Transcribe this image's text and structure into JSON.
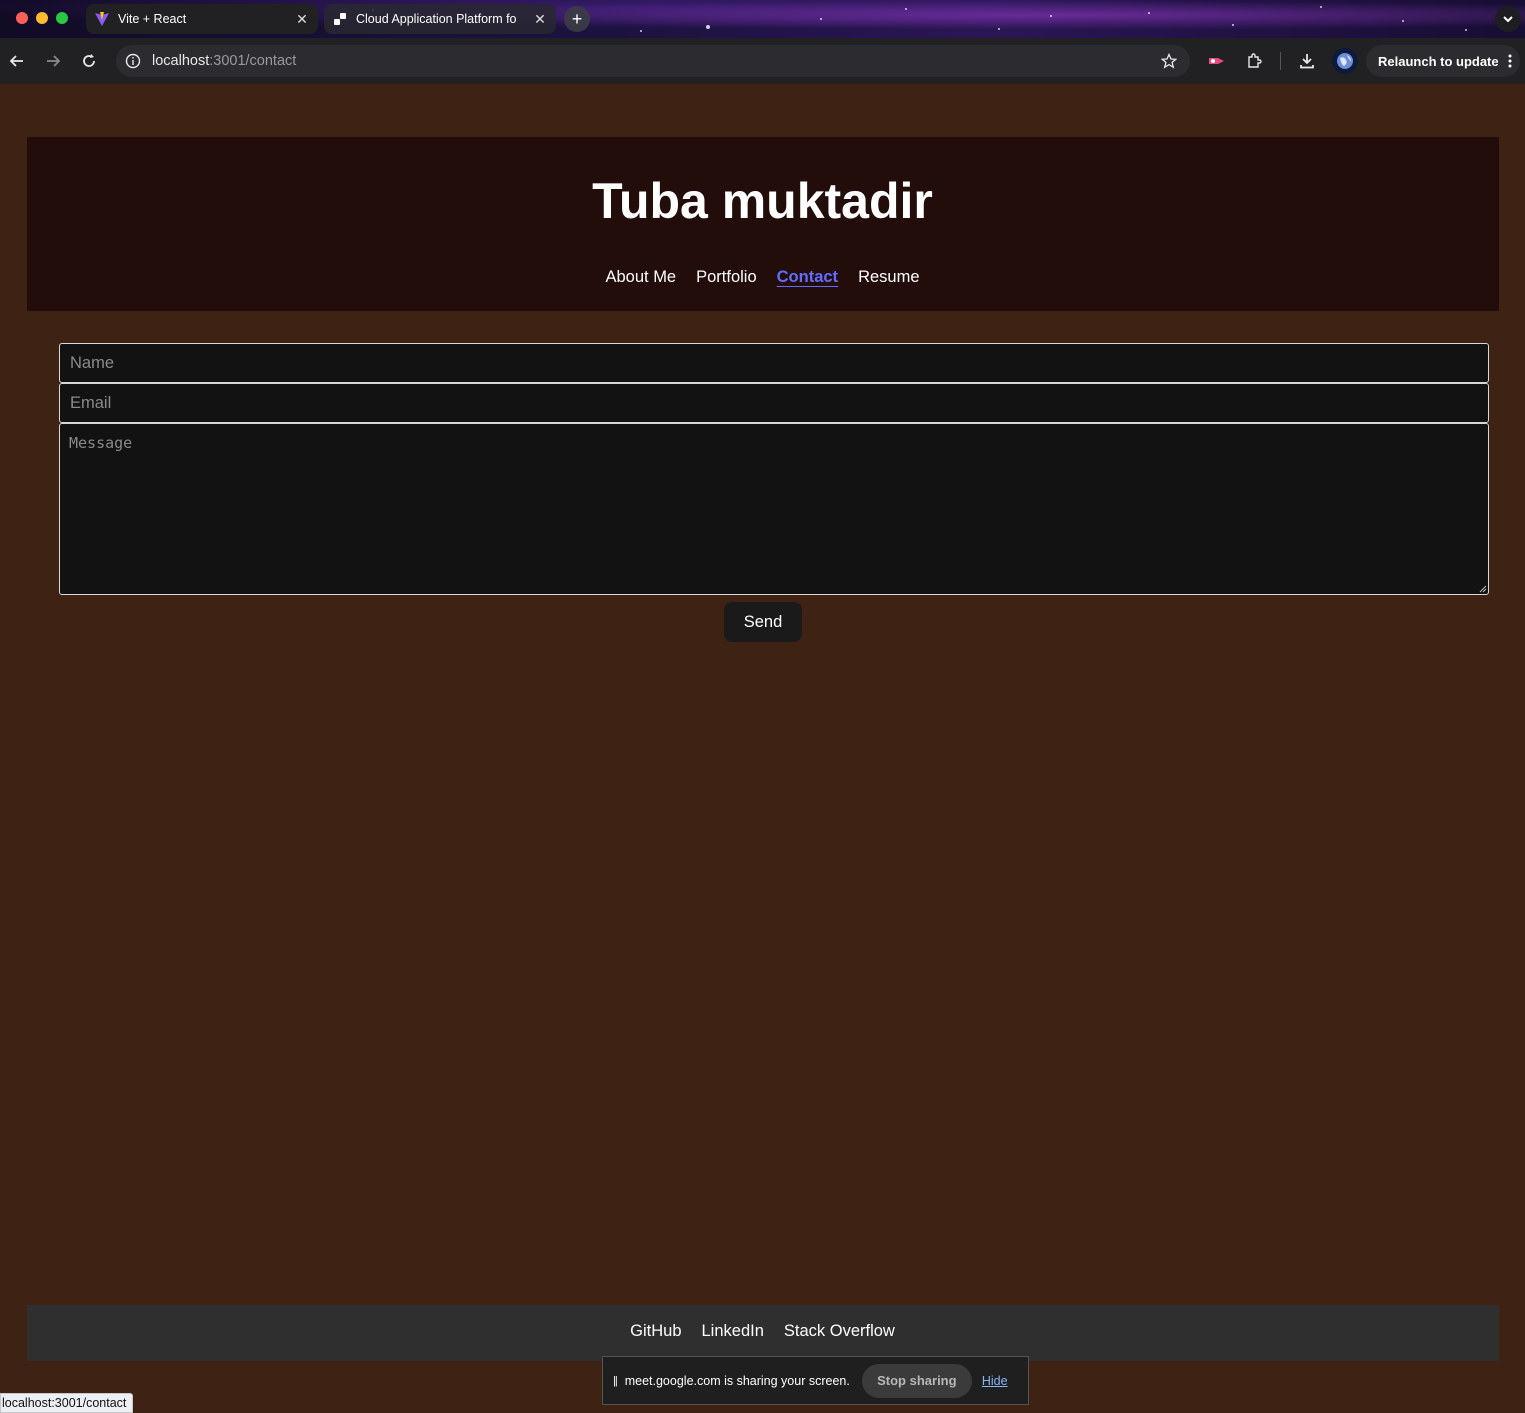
{
  "browser": {
    "tabs": [
      {
        "title": "Vite + React",
        "icon": "vite-icon",
        "active": true
      },
      {
        "title": "Cloud Application Platform fo",
        "icon": "cloud-platform-icon",
        "active": false
      }
    ],
    "new_tab_label": "+",
    "address": {
      "host": "localhost",
      "path": ":3001/contact"
    },
    "relaunch_label": "Relaunch to update"
  },
  "site": {
    "title": "Tuba muktadir",
    "nav": [
      {
        "label": "About Me",
        "active": false
      },
      {
        "label": "Portfolio",
        "active": false
      },
      {
        "label": "Contact",
        "active": true
      },
      {
        "label": "Resume",
        "active": false
      }
    ],
    "accent_color": "#646cff"
  },
  "form": {
    "name_placeholder": "Name",
    "email_placeholder": "Email",
    "message_placeholder": "Message",
    "send_label": "Send"
  },
  "footer": {
    "links": [
      "GitHub",
      "LinkedIn",
      "Stack Overflow"
    ]
  },
  "screen_share": {
    "message": "meet.google.com is sharing your screen.",
    "stop_label": "Stop sharing",
    "hide_label": "Hide"
  },
  "status_url": "localhost:3001/contact"
}
